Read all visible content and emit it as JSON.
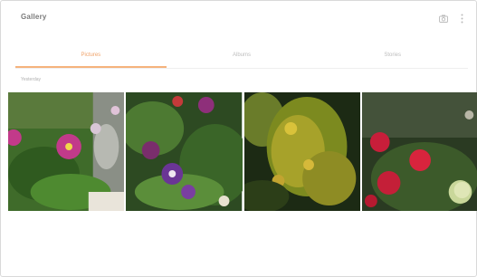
{
  "app": {
    "title": "Gallery",
    "icons": [
      "camera-icon",
      "more-options-icon"
    ]
  },
  "tabs": [
    {
      "label": "Pictures",
      "active": true
    },
    {
      "label": "Albums",
      "active": false
    },
    {
      "label": "Stories",
      "active": false
    }
  ],
  "section": {
    "label": "Yesterday"
  },
  "photos": [
    {
      "subject": "pink-flowers"
    },
    {
      "subject": "purple-columbine-flowers"
    },
    {
      "subject": "yellow-shrub"
    },
    {
      "subject": "red-flowers-and-fruit"
    }
  ],
  "colors": {
    "accent": "#f5b27c",
    "tab_inactive": "#bdbdbd",
    "title": "#7a7a7a"
  }
}
